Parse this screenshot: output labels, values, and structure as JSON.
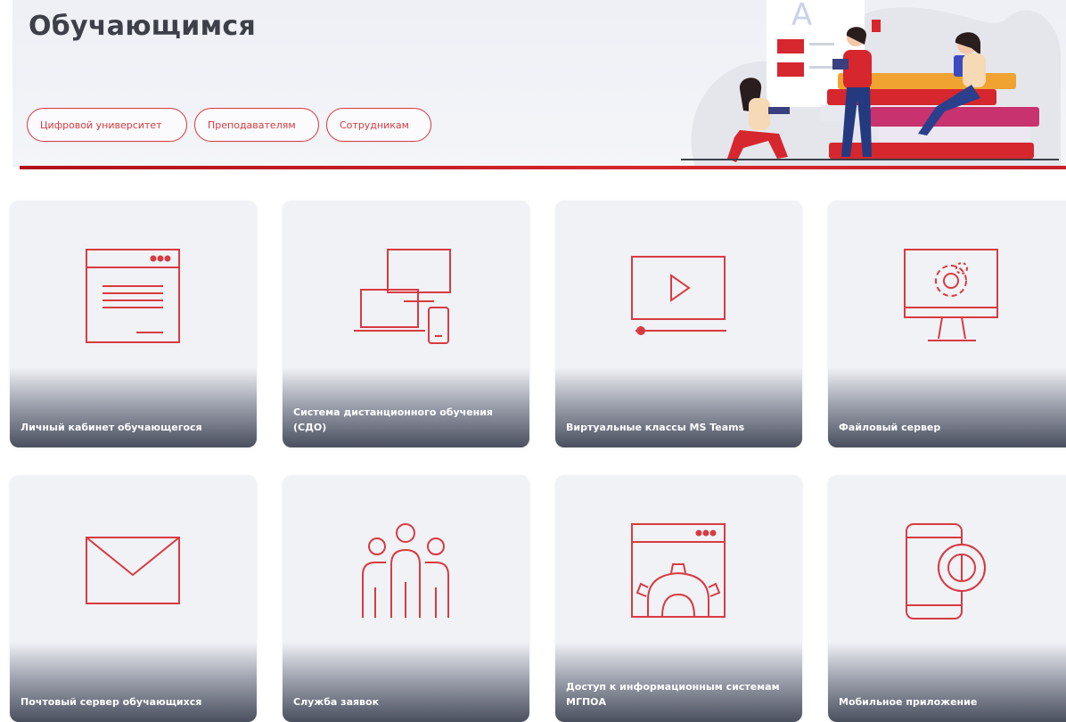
{
  "header": {
    "title": "Обучающимся",
    "pills": [
      "Цифровой университет",
      "Преподавателям",
      "Сотрудникам"
    ]
  },
  "tiles": [
    {
      "label": "Личный кабинет обучающегося",
      "icon": "browser-window-icon"
    },
    {
      "label": "Система дистанционного обучения (СДО)",
      "icon": "devices-icon"
    },
    {
      "label": "Виртуальные классы MS Teams",
      "icon": "video-player-icon"
    },
    {
      "label": "Файловый сервер",
      "icon": "monitor-gear-icon"
    },
    {
      "label": "Почтовый сервер обучающихся",
      "icon": "envelope-icon"
    },
    {
      "label": "Служба заявок",
      "icon": "people-group-icon"
    },
    {
      "label": "Доступ к информационным системам МГПОА",
      "icon": "window-gear-icon"
    },
    {
      "label": "Мобильное приложение",
      "icon": "phone-gear-icon"
    }
  ],
  "colors": {
    "accent": "#d6262e",
    "icon": "#d73b42",
    "title": "#3d4048",
    "tile_bg": "#f1f2f6"
  }
}
